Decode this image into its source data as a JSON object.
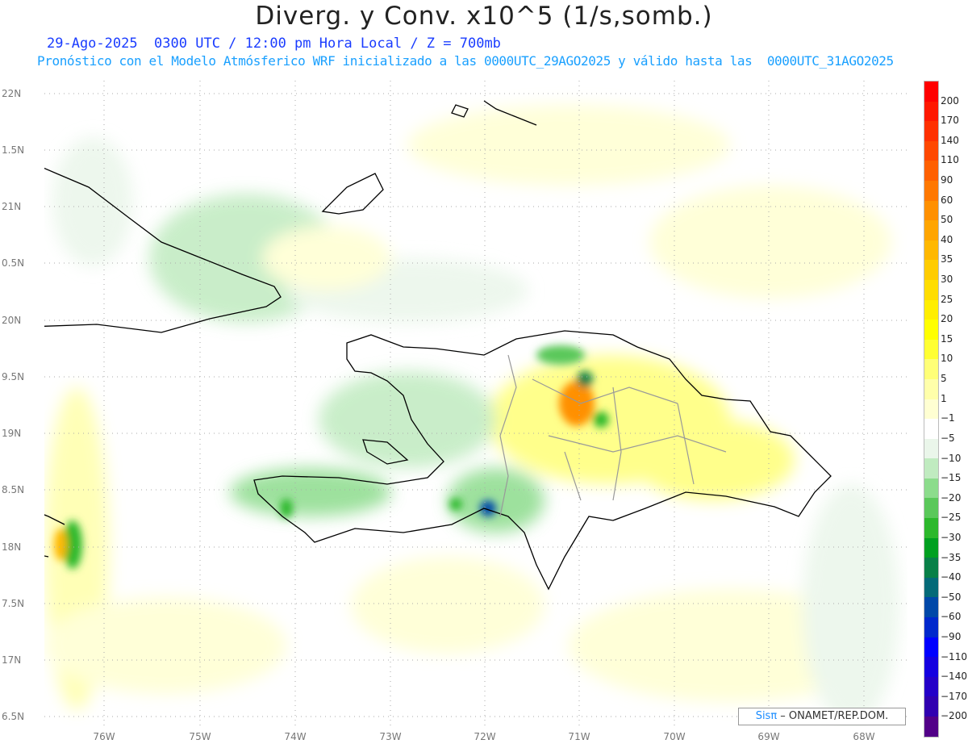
{
  "title": "Diverg. y Conv. x10^5 (1/s,somb.)",
  "subtitle_time": "29-Ago-2025  0300 UTC / 12:00 pm Hora Local / Z = 700mb",
  "subtitle_model": "Pronóstico con el Modelo Atmósferico WRF inicializado a las 0000UTC_29AGO2025 y válido hasta las  0000UTC_31AGO2025",
  "lat_labels": [
    "22N",
    "1.5N",
    "21N",
    "0.5N",
    "20N",
    "9.5N",
    "19N",
    "8.5N",
    "18N",
    "7.5N",
    "17N",
    "6.5N"
  ],
  "lon_labels": [
    "76W",
    "75W",
    "74W",
    "73W",
    "72W",
    "71W",
    "70W",
    "69W",
    "68W"
  ],
  "colorbar": {
    "labels": [
      "200",
      "170",
      "140",
      "110",
      "90",
      "60",
      "50",
      "40",
      "35",
      "30",
      "25",
      "20",
      "15",
      "10",
      "5",
      "1",
      "−1",
      "−5",
      "−10",
      "−15",
      "−20",
      "−25",
      "−30",
      "−35",
      "−40",
      "−50",
      "−60",
      "−90",
      "−110",
      "−140",
      "−170",
      "−200"
    ],
    "colors": [
      "#ff0000",
      "#ff1800",
      "#ff3000",
      "#ff4800",
      "#ff6000",
      "#ff7800",
      "#ff9000",
      "#ffa500",
      "#ffb800",
      "#ffcc00",
      "#ffdd00",
      "#ffee00",
      "#ffff00",
      "#ffff33",
      "#ffff77",
      "#ffffaa",
      "#ffffd2",
      "#ffffff",
      "#eaf6ea",
      "#c0ebc0",
      "#8cdc8c",
      "#5ac85a",
      "#2cb82c",
      "#00a020",
      "#088048",
      "#046a78",
      "#0048a8",
      "#0028cc",
      "#0000ff",
      "#1400e0",
      "#2400c8",
      "#3000b0",
      "#520088"
    ]
  },
  "credit": {
    "brand": "Sisπ",
    "text": " – ONAMET/REP.DOM."
  }
}
